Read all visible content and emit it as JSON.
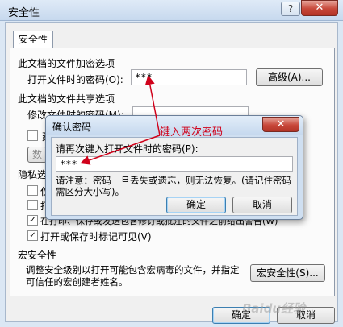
{
  "window": {
    "title": "安全性",
    "help_label": "?",
    "close_label": "✕"
  },
  "tab": {
    "label": "安全性"
  },
  "encryption": {
    "heading": "此文档的文件加密选项",
    "open_password_label": "打开文件时的密码(O):",
    "open_password_value": "***",
    "advanced_button": "高级(A)..."
  },
  "sharing": {
    "heading": "此文档的文件共享选项",
    "modify_password_label": "修改文件时的密码(M):",
    "readonly_fragment": "建",
    "protect_button_fragment": "数"
  },
  "privacy": {
    "heading": "隐私选项",
    "options": [
      {
        "label": "仅",
        "checked": false
      },
      {
        "label": "打",
        "checked": false
      },
      {
        "label": "在打印、保存或发送包含修订或批注的文件之前给出警告(W)",
        "checked": true
      },
      {
        "label": "打开或保存时标记可见(V)",
        "checked": true
      }
    ]
  },
  "macro": {
    "heading": "宏安全性",
    "description": "调整安全级别以打开可能包含宏病毒的文件，并指定可信任的宏创建者姓名。",
    "button": "宏安全性(S)..."
  },
  "footer": {
    "ok_button": "确定",
    "cancel_button": "取消"
  },
  "confirm_dialog": {
    "title": "确认密码",
    "close_label": "✕",
    "prompt": "请再次键入打开文件时的密码(P):",
    "password_value": "***",
    "notice": "请注意：密码一旦丢失或遗忘，则无法恢复。(请记住密码需区分大小写)。",
    "ok_button": "确定",
    "cancel_button": "取消"
  },
  "annotation": {
    "text": "键入两次密码",
    "color": "#d0021b"
  },
  "watermark": "Baidu经验"
}
